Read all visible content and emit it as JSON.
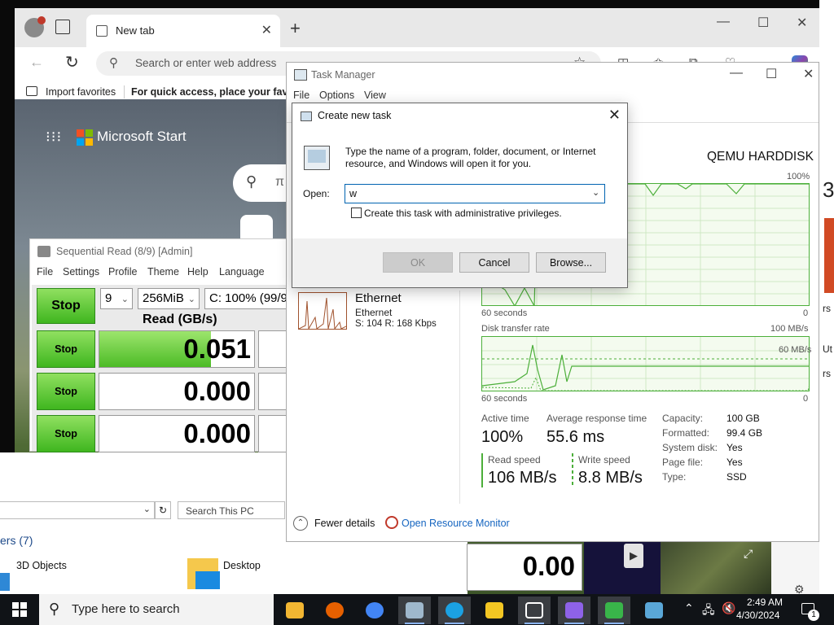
{
  "edge": {
    "tab_title": "New tab",
    "address_placeholder": "Search or enter web address",
    "fav_import": "Import favorites",
    "fav_hint": "For quick access, place your favorites here",
    "brand": "Microsoft Start",
    "search_hint": "π",
    "colors": {
      "logo": [
        "#f25022",
        "#7fba00",
        "#00a4ef",
        "#ffb900"
      ]
    }
  },
  "cdm": {
    "title": "Sequential Read (8/9) [Admin]",
    "menu": [
      "File",
      "Settings",
      "Profile",
      "Theme",
      "Help",
      "Language"
    ],
    "count": "9",
    "size": "256MiB",
    "drive": "C: 100% (99/99GiB)",
    "header": "Read (GB/s)",
    "stop_all": "Stop",
    "rows": [
      {
        "button": "Stop",
        "value": "0.051",
        "level": 0.72
      },
      {
        "button": "Stop",
        "value": "0.000",
        "level": 0
      },
      {
        "button": "Stop",
        "value": "0.000",
        "level": 0
      }
    ]
  },
  "explorer": {
    "search_placeholder": "Search This PC",
    "section": "ers (7)",
    "items": [
      {
        "label": "3D Objects"
      },
      {
        "label": "Desktop"
      }
    ]
  },
  "taskmgr": {
    "title": "Task Manager",
    "menu": [
      "File",
      "Options",
      "View"
    ],
    "disk_name": "QEMU HARDDISK",
    "graph1": {
      "max_label": "100%",
      "time_label": "60 seconds",
      "zero_label": "0"
    },
    "graph2": {
      "title": "Disk transfer rate",
      "max_label": "100 MB/s",
      "mid_label": "60 MB/s",
      "time_label": "60 seconds",
      "zero_label": "0"
    },
    "ethernet": {
      "name": "Ethernet",
      "sub": "Ethernet",
      "stat": "S: 104  R: 168 Kbps"
    },
    "stats": {
      "active_time_label": "Active time",
      "active_time": "100%",
      "avg_resp_label": "Average response time",
      "avg_resp": "55.6 ms",
      "read_label": "Read speed",
      "read": "106 MB/s",
      "write_label": "Write speed",
      "write": "8.8 MB/s"
    },
    "props": [
      {
        "label": "Capacity:",
        "value": "100 GB"
      },
      {
        "label": "Formatted:",
        "value": "99.4 GB"
      },
      {
        "label": "System disk:",
        "value": "Yes"
      },
      {
        "label": "Page file:",
        "value": "Yes"
      },
      {
        "label": "Type:",
        "value": "SSD"
      }
    ],
    "fewer_details": "Fewer details",
    "resource_monitor": "Open Resource Monitor"
  },
  "run": {
    "title": "Create new task",
    "description": "Type the name of a program, folder, document, or Internet resource, and Windows will open it for you.",
    "open_label": "Open:",
    "input_value": "w",
    "checkbox_label": "Create this task with administrative privileges.",
    "ok": "OK",
    "cancel": "Cancel",
    "browse": "Browse..."
  },
  "background": {
    "strip_value": "0.00",
    "right_texts": [
      "3",
      "rs",
      "Ut",
      "rs"
    ]
  },
  "taskbar": {
    "search_placeholder": "Type here to search",
    "time": "2:49 AM",
    "date": "4/30/2024",
    "notifications": "1",
    "apps": [
      {
        "icon": "file-explorer-icon",
        "color": "#f2b632"
      },
      {
        "icon": "firefox-icon",
        "color": "#e66000"
      },
      {
        "icon": "chrome-icon",
        "color": "#4285f4"
      },
      {
        "icon": "task-manager-icon",
        "color": "#9fb8cc"
      },
      {
        "icon": "edge-icon",
        "color": "#1ba1e2"
      },
      {
        "icon": "store-icon",
        "color": "#f3c623"
      },
      {
        "icon": "cube-icon",
        "color": "#ffffff"
      },
      {
        "icon": "copilot-icon",
        "color": "#8e62e8"
      },
      {
        "icon": "disk-mark-icon",
        "color": "#39b54a"
      },
      {
        "icon": "window-app-icon",
        "color": "#5aa7d8"
      }
    ]
  }
}
